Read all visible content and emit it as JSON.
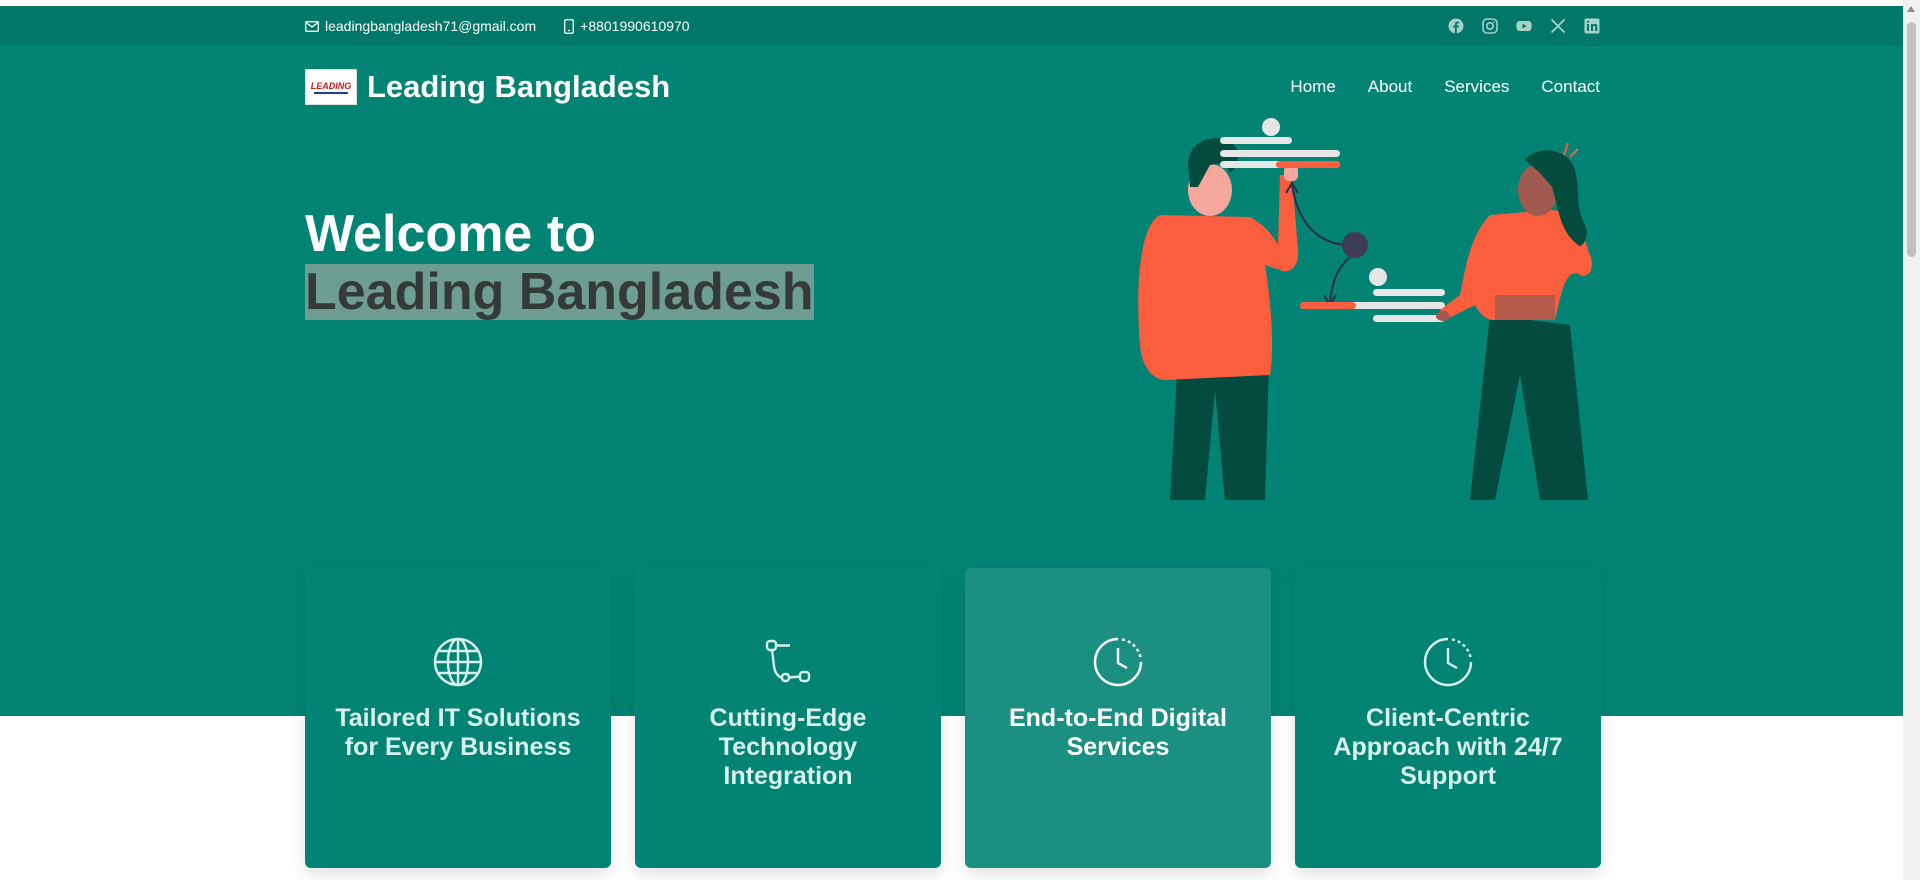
{
  "topbar": {
    "email": "leadingbangladesh71@gmail.com",
    "phone": "+8801990610970",
    "socials": [
      "facebook-icon",
      "instagram-icon",
      "youtube-icon",
      "x-icon",
      "linkedin-icon"
    ]
  },
  "nav": {
    "brand": "Leading Bangladesh",
    "logo_text": "LEADING",
    "items": [
      "Home",
      "About",
      "Services",
      "Contact"
    ]
  },
  "hero": {
    "line1": "Welcome to",
    "line2": "Leading Bangladesh"
  },
  "features": [
    {
      "title": "Tailored IT Solutions for Every Business",
      "icon": "globe-icon"
    },
    {
      "title": "Cutting-Edge Technology Integration",
      "icon": "bezier-icon"
    },
    {
      "title": "End-to-End Digital Services",
      "icon": "clock-icon"
    },
    {
      "title": "Client-Centric Approach with 24/7 Support",
      "icon": "clock-icon"
    }
  ],
  "colors": {
    "topbar": "#01776a",
    "hero": "#028374",
    "accent": "#fa5e3f",
    "dark_green": "#024b3e"
  }
}
